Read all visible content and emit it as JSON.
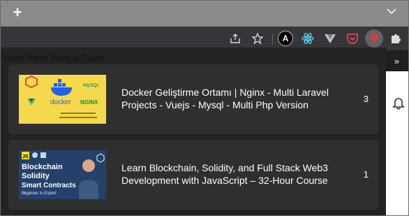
{
  "browser": {
    "new_tab_glyph": "+",
    "tab_search_icon": "chevron-down-icon",
    "extensions": [
      "share-icon",
      "star-icon",
      "a-icon",
      "react-icon",
      "vue-icon",
      "pocket-icon",
      "pin-icon",
      "puzzle-icon"
    ],
    "extension_a_glyph": "A"
  },
  "page": {
    "header_glyph": "»"
  },
  "popup": {
    "columns": [
      "Video Name",
      "Markup Count"
    ],
    "rows": [
      {
        "title": "Docker Geliştirme Ortamı | Nginx - Multi Laravel Projects - Vuejs - Mysql - Multi Php Version",
        "count": "3",
        "thumb": {
          "labels": [
            "docker",
            "MySQL",
            "NGINX"
          ],
          "background": "#f6d94a"
        }
      },
      {
        "title": "Learn Blockchain, Solidity, and Full Stack Web3 Development with JavaScript – 32-Hour Course",
        "count": "1",
        "thumb": {
          "labels": [
            "Blockchain",
            "Solidity",
            "Smart Contracts",
            "Beginner to Expert",
            "JS"
          ],
          "background": "#24406b"
        }
      }
    ]
  },
  "colors": {
    "popup_bg": "#232323",
    "card_bg": "#2f2f2f",
    "accent_red": "#e53935",
    "pocket_red": "#ef4056",
    "react_blue": "#61dafb"
  }
}
